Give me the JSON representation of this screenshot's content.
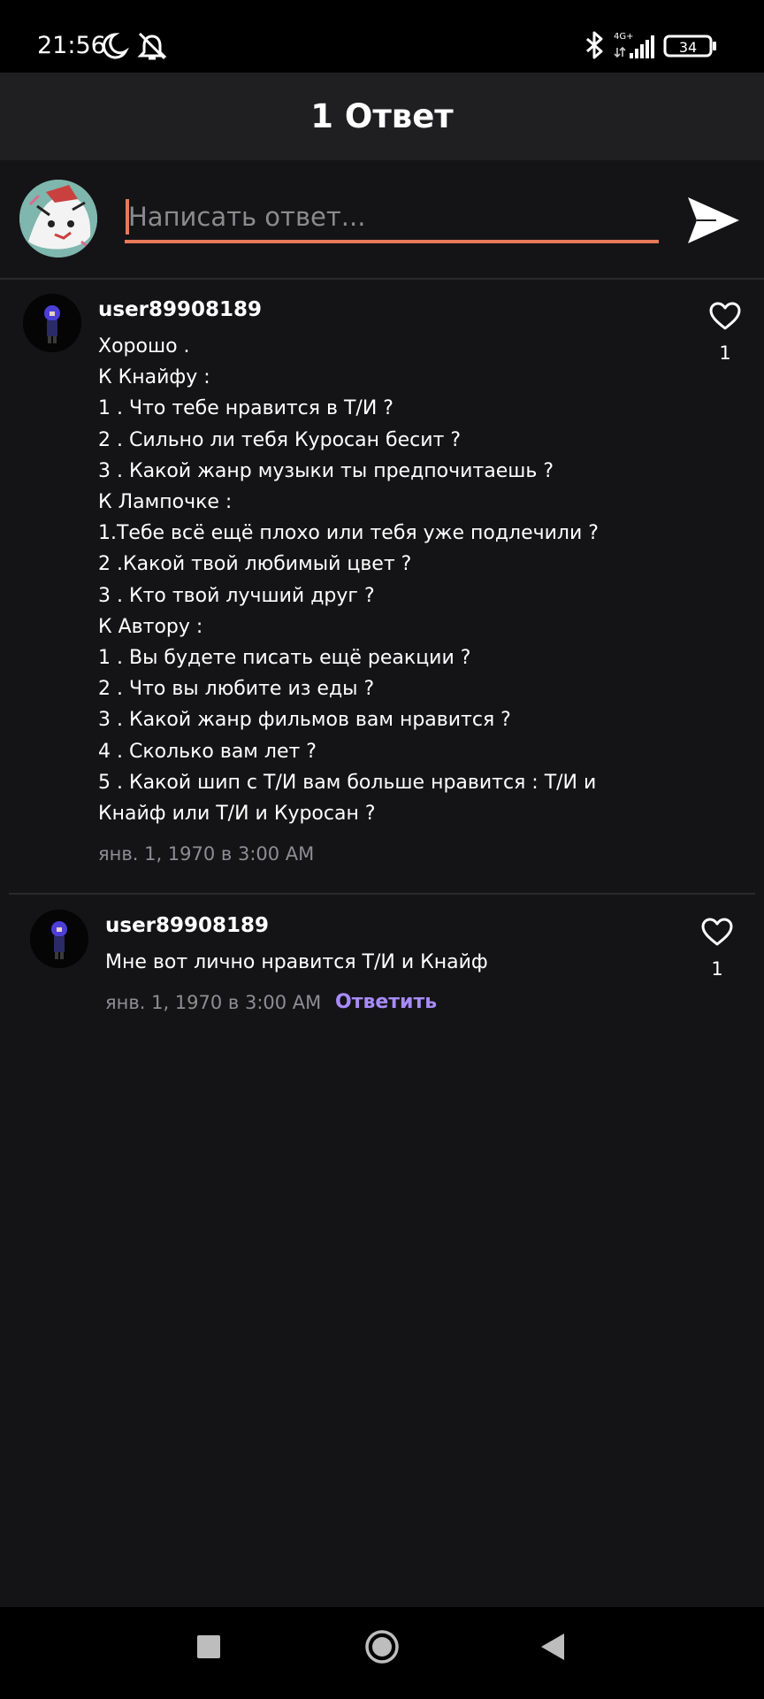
{
  "status_bar": {
    "time": "21:56",
    "icons": [
      "moon-icon",
      "bell-off-icon",
      "bluetooth-icon",
      "network-4g-plus-icon",
      "signal-icon",
      "battery-icon"
    ],
    "network_label": "4G+",
    "battery_level": "34"
  },
  "header": {
    "title": "1 Ответ"
  },
  "compose": {
    "placeholder": "Написать ответ...",
    "value": "",
    "send_icon": "send-icon",
    "accent_color": "#e8795a"
  },
  "comments": [
    {
      "username": "user89908189",
      "lines": [
        "Хорошо .",
        "К Кнайфу :",
        "1 . Что тебе нравится в Т/И ?",
        "2 . Сильно ли тебя Куросан бесит ?",
        "3 . Какой жанр музыки ты предпочитаешь ?",
        "К Лампочке :",
        "1.Тебе всё ещё плохо или тебя уже подлечили ?",
        "2 .Какой твой любимый цвет ?",
        "3 . Кто твой лучший друг ?",
        "К Автору :",
        "1 . Вы будете писать ещё реакции ?",
        "2 . Что вы любите из еды ?",
        "3 . Какой жанр фильмов вам нравится ?",
        "4 . Сколько вам лет ?",
        "5 . Какой шип с Т/И вам больше нравится : Т/И и",
        "Кнайф или Т/И и Куросан ?"
      ],
      "timestamp": "янв. 1, 1970 в 3:00 AM",
      "likes": "1"
    },
    {
      "username": "user89908189",
      "lines": [
        "Мне вот лично нравится Т/И и Кнайф"
      ],
      "timestamp": "янв. 1, 1970 в 3:00 AM",
      "reply_label": "Ответить",
      "likes": "1"
    }
  ],
  "colors": {
    "background": "#141416",
    "header": "#1f1f21",
    "reply_link": "#a78bfa",
    "muted_text": "#8e8e92"
  },
  "nav_bar": {
    "buttons": [
      "recent-apps-icon",
      "home-icon",
      "back-icon"
    ]
  }
}
